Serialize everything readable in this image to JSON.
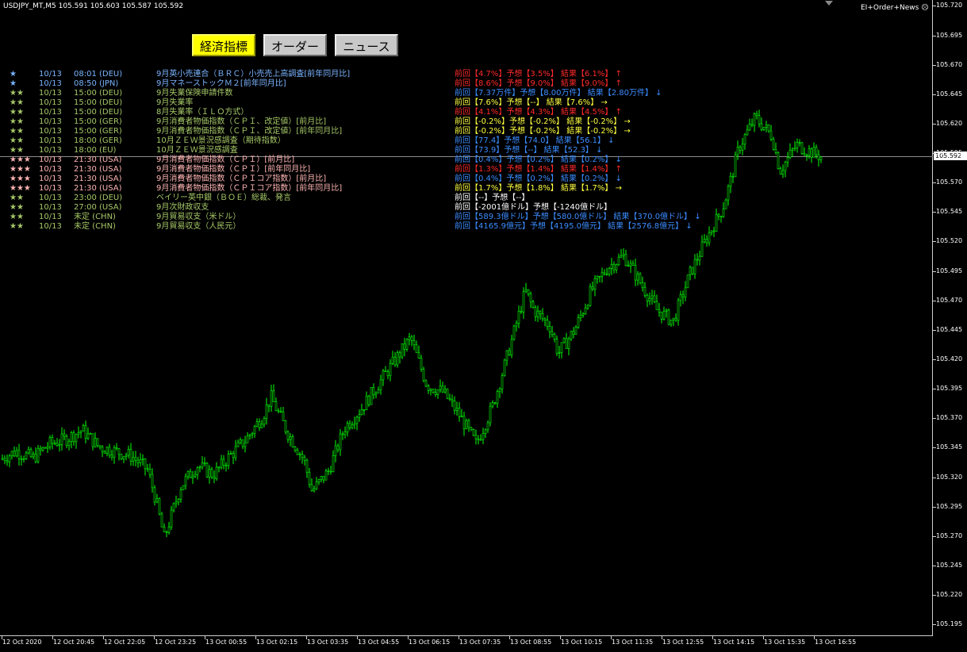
{
  "header": {
    "symbol": "USDJPY_MT,M5",
    "ohlc": "105.591 105.603 105.587 105.592",
    "indicator": "EI+Order+News",
    "indicator_icon": "smiley-icon"
  },
  "tabs": [
    {
      "label": "経済指標",
      "active": true
    },
    {
      "label": "オーダー",
      "active": false
    },
    {
      "label": "ニュース",
      "active": false
    }
  ],
  "colors": {
    "bull": "#00ff00",
    "bear": "#ffffff",
    "star_row": "#7ab4ff",
    "green_row": "#a6c867",
    "pink_row": "#ffb4b4",
    "red": "#ff2a2a",
    "blue": "#3b8dff",
    "yellow": "#ffff40",
    "white": "#ffffff"
  },
  "events": [
    {
      "stars": "★",
      "date": "10/13",
      "time": "08:01 (DEU)",
      "name": "9月英小売連合（ＢＲＣ）小売売上高調査[前年同月比]",
      "result": "前回【4.7%】予想【3.5%】 結果【6.1%】 ↑",
      "row": "star_row",
      "res": "red"
    },
    {
      "stars": "★",
      "date": "10/13",
      "time": "08:50 (JPN)",
      "name": "9月マネーストックＭ２[前年同月比]",
      "result": "前回【8.6%】予想【9.0%】 結果【9.0%】 ↑",
      "row": "star_row",
      "res": "red"
    },
    {
      "stars": "★★",
      "date": "10/13",
      "time": "15:00 (DEU)",
      "name": "9月失業保険申請件数",
      "result": "前回【7.37万件】予想【8.00万件】 結果【2.80万件】 ↓",
      "row": "green_row",
      "res": "blue"
    },
    {
      "stars": "★★",
      "date": "10/13",
      "time": "15:00 (DEU)",
      "name": "9月失業率",
      "result": "前回【7.6%】予想【--】 結果【7.6%】 →",
      "row": "green_row",
      "res": "yellow"
    },
    {
      "stars": "★★",
      "date": "10/13",
      "time": "15:00 (DEU)",
      "name": "8月失業率（ＩＬＯ方式）",
      "result": "前回【4.1%】予想【4.3%】 結果【4.5%】 ↑",
      "row": "green_row",
      "res": "red"
    },
    {
      "stars": "★★",
      "date": "10/13",
      "time": "15:00 (GER)",
      "name": "9月消費者物価指数（ＣＰＩ、改定値）[前月比]",
      "result": "前回【-0.2%】予想【-0.2%】 結果【-0.2%】 →",
      "row": "green_row",
      "res": "yellow"
    },
    {
      "stars": "★★",
      "date": "10/13",
      "time": "15:00 (GER)",
      "name": "9月消費者物価指数（ＣＰＩ、改定値）[前年同月比]",
      "result": "前回【-0.2%】予想【-0.2%】 結果【-0.2%】 →",
      "row": "green_row",
      "res": "yellow"
    },
    {
      "stars": "★★",
      "date": "10/13",
      "time": "18:00 (GER)",
      "name": "10月ＺＥＷ景況感調査（期待指数）",
      "result": "前回【77.4】予想【74.0】 結果【56.1】 ↓",
      "row": "green_row",
      "res": "blue"
    },
    {
      "stars": "★★",
      "date": "10/13",
      "time": "18:00 (EU)",
      "name": "10月ＺＥＷ景況感調査",
      "result": "前回【73.9】予想【--】 結果【52.3】 ↓",
      "row": "green_row",
      "res": "blue"
    },
    {
      "stars": "★★★",
      "date": "10/13",
      "time": "21:30 (USA)",
      "name": "9月消費者物価指数（ＣＰＩ）[前月比]",
      "result": "前回【0.4%】予想【0.2%】 結果【0.2%】 ↓",
      "row": "pink_row",
      "res": "blue"
    },
    {
      "stars": "★★★",
      "date": "10/13",
      "time": "21:30 (USA)",
      "name": "9月消費者物価指数（ＣＰＩ）[前年同月比]",
      "result": "前回【1.3%】予想【1.4%】 結果【1.4%】 ↑",
      "row": "pink_row",
      "res": "red"
    },
    {
      "stars": "★★★",
      "date": "10/13",
      "time": "21:30 (USA)",
      "name": "9月消費者物価指数（ＣＰＩコア指数）[前月比]",
      "result": "前回【0.4%】予想【0.2%】 結果【0.2%】 ↓",
      "row": "pink_row",
      "res": "blue"
    },
    {
      "stars": "★★★",
      "date": "10/13",
      "time": "21:30 (USA)",
      "name": "9月消費者物価指数（ＣＰＩコア指数）[前年同月比]",
      "result": "前回【1.7%】予想【1.8%】 結果【1.7%】 →",
      "row": "pink_row",
      "res": "yellow"
    },
    {
      "stars": "★★",
      "date": "10/13",
      "time": "23:00 (DEU)",
      "name": "ベイリー英中銀（ＢＯＥ）総裁、発言",
      "result": "前回【--】予想【--】",
      "row": "green_row",
      "res": "white"
    },
    {
      "stars": "★★",
      "date": "10/13",
      "time": "27:00 (USA)",
      "name": "9月次財政収支",
      "result": "前回【-2001億ドル】予想【-1240億ドル】",
      "row": "green_row",
      "res": "white"
    },
    {
      "stars": "★★",
      "date": "10/13",
      "time": "未定 (CHN)",
      "name": "9月貿易収支（米ドル）",
      "result": "前回【589.3億ドル】予想【580.0億ドル】 結果【370.0億ドル】 ↓",
      "row": "green_row",
      "res": "blue"
    },
    {
      "stars": "★★",
      "date": "10/13",
      "time": "未定 (CHN)",
      "name": "9月貿易収支（人民元）",
      "result": "前回【4165.9億元】予想【4195.0億元】 結果【2576.8億元】 ↓",
      "row": "green_row",
      "res": "blue"
    }
  ],
  "price_axis": {
    "labels": [
      "105.720",
      "105.695",
      "105.670",
      "105.645",
      "105.620",
      "105.595",
      "105.570",
      "105.545",
      "105.520",
      "105.495",
      "105.470",
      "105.445",
      "105.420",
      "105.395",
      "105.370",
      "105.345",
      "105.320",
      "105.295",
      "105.270",
      "105.245",
      "105.220",
      "105.195"
    ],
    "current": "105.592"
  },
  "time_axis": {
    "labels": [
      "12 Oct 2020",
      "12 Oct 20:45",
      "12 Oct 22:05",
      "12 Oct 23:25",
      "13 Oct 00:55",
      "13 Oct 02:15",
      "13 Oct 03:35",
      "13 Oct 04:55",
      "13 Oct 06:15",
      "13 Oct 07:35",
      "13 Oct 08:55",
      "13 Oct 10:15",
      "13 Oct 11:35",
      "13 Oct 12:55",
      "13 Oct 14:15",
      "13 Oct 15:35",
      "13 Oct 16:55"
    ]
  },
  "chart_data": {
    "type": "candlestick",
    "symbol": "USDJPY_MT",
    "timeframe": "M5",
    "ylim": [
      105.185,
      105.725
    ],
    "current_price": 105.592,
    "close_path": [
      [
        0,
        105.335
      ],
      [
        0.02,
        105.342
      ],
      [
        0.04,
        105.336
      ],
      [
        0.06,
        105.348
      ],
      [
        0.08,
        105.352
      ],
      [
        0.1,
        105.36
      ],
      [
        0.12,
        105.346
      ],
      [
        0.14,
        105.342
      ],
      [
        0.16,
        105.338
      ],
      [
        0.18,
        105.326
      ],
      [
        0.19,
        105.3
      ],
      [
        0.2,
        105.268
      ],
      [
        0.22,
        105.312
      ],
      [
        0.24,
        105.33
      ],
      [
        0.26,
        105.322
      ],
      [
        0.28,
        105.338
      ],
      [
        0.3,
        105.352
      ],
      [
        0.32,
        105.372
      ],
      [
        0.33,
        105.388
      ],
      [
        0.35,
        105.358
      ],
      [
        0.37,
        105.335
      ],
      [
        0.38,
        105.308
      ],
      [
        0.4,
        105.325
      ],
      [
        0.42,
        105.362
      ],
      [
        0.44,
        105.378
      ],
      [
        0.46,
        105.398
      ],
      [
        0.48,
        105.418
      ],
      [
        0.5,
        105.438
      ],
      [
        0.52,
        105.398
      ],
      [
        0.54,
        105.392
      ],
      [
        0.56,
        105.372
      ],
      [
        0.58,
        105.348
      ],
      [
        0.6,
        105.38
      ],
      [
        0.62,
        105.428
      ],
      [
        0.64,
        105.478
      ],
      [
        0.65,
        105.462
      ],
      [
        0.67,
        105.448
      ],
      [
        0.68,
        105.425
      ],
      [
        0.7,
        105.445
      ],
      [
        0.72,
        105.478
      ],
      [
        0.74,
        105.498
      ],
      [
        0.76,
        105.508
      ],
      [
        0.78,
        105.485
      ],
      [
        0.8,
        105.462
      ],
      [
        0.82,
        105.452
      ],
      [
        0.84,
        105.492
      ],
      [
        0.86,
        105.522
      ],
      [
        0.88,
        105.548
      ],
      [
        0.89,
        105.572
      ],
      [
        0.9,
        105.6
      ],
      [
        0.92,
        105.625
      ],
      [
        0.94,
        105.61
      ],
      [
        0.95,
        105.58
      ],
      [
        0.97,
        105.602
      ],
      [
        1.0,
        105.592
      ]
    ]
  }
}
